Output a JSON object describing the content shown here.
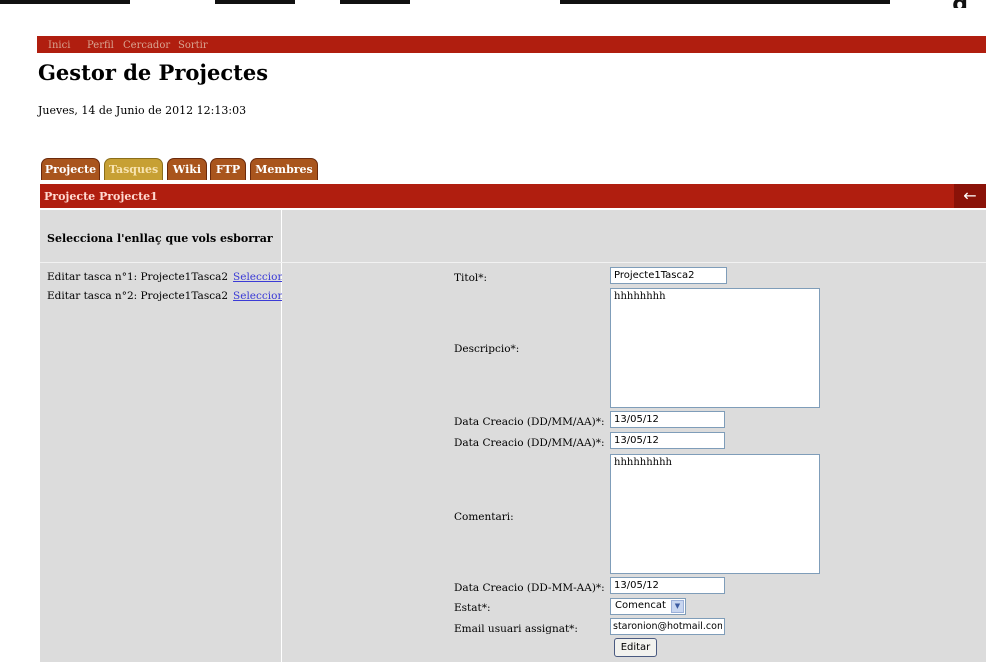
{
  "menu": {
    "items": [
      "Inici",
      "Perfil",
      "Cercador",
      "Sortir"
    ]
  },
  "header": {
    "title": "Gestor de Projectes",
    "date": "Jueves, 14 de Junio de 2012 12:13:03"
  },
  "tabs": [
    {
      "label": "Projecte",
      "active": false
    },
    {
      "label": "Tasques",
      "active": true
    },
    {
      "label": "Wiki",
      "active": false
    },
    {
      "label": "FTP",
      "active": false
    },
    {
      "label": "Membres",
      "active": false
    }
  ],
  "section": {
    "title": "Projecte Projecte1",
    "back_icon": "arrow-left-icon"
  },
  "left": {
    "heading": "Selecciona l'enllaç que vols esborrar",
    "tasks": [
      {
        "text": "Editar tasca n°1: Projecte1Tasca2",
        "link": "Seleccionar"
      },
      {
        "text": "Editar tasca n°2: Projecte1Tasca2",
        "link": "Seleccionar"
      }
    ]
  },
  "form": {
    "titol_label": "Titol*:",
    "titol_value": "Projecte1Tasca2",
    "descripcio_label": "Descripcio*:",
    "descripcio_value": "hhhhhhhh",
    "data1_label": "Data Creacio (DD/MM/AA)*:",
    "data1_value": "13/05/12",
    "data2_label": "Data Creacio (DD/MM/AA)*:",
    "data2_value": "13/05/12",
    "comentari_label": "Comentari:",
    "comentari_value": "hhhhhhhhh",
    "data3_label": "Data Creacio (DD-MM-AA)*:",
    "data3_value": "13/05/12",
    "estat_label": "Estat*:",
    "estat_value": "Comencat",
    "email_label": "Email usuari assignat*:",
    "email_value": "staronion@hotmail.com",
    "submit_label": "Editar"
  }
}
